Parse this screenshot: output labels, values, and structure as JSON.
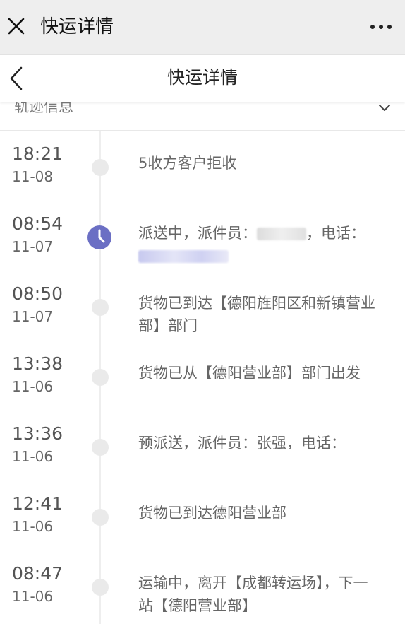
{
  "topbar": {
    "title": "快运详情",
    "close_icon": "close-icon",
    "more_icon": "more-icon"
  },
  "navbar": {
    "title": "快运详情",
    "back_icon": "back-chevron-icon"
  },
  "section": {
    "label": "轨迹信息",
    "toggle_icon": "chevron-down-icon"
  },
  "colors": {
    "accent": "#6b6fc4",
    "timeline_dot": "#eaeaea",
    "text_gray": "#666666"
  },
  "events": [
    {
      "time": "18:21",
      "date": "11-08",
      "desc": "5收方客户拒收"
    },
    {
      "time": "08:54",
      "date": "11-07",
      "desc_prefix": "派送中，派件员：",
      "desc_mid": "，电话：",
      "desc": ""
    },
    {
      "time": "08:50",
      "date": "11-07",
      "desc": "货物已到达【德阳旌阳区和新镇营业部】部门"
    },
    {
      "time": "13:38",
      "date": "11-06",
      "desc": "货物已从【德阳营业部】部门出发"
    },
    {
      "time": "13:36",
      "date": "11-06",
      "desc": "预派送，派件员：张强，电话："
    },
    {
      "time": "12:41",
      "date": "11-06",
      "desc": "货物已到达德阳营业部"
    },
    {
      "time": "08:47",
      "date": "11-06",
      "desc": "运输中，离开【成都转运场】，下一站【德阳营业部】"
    }
  ]
}
